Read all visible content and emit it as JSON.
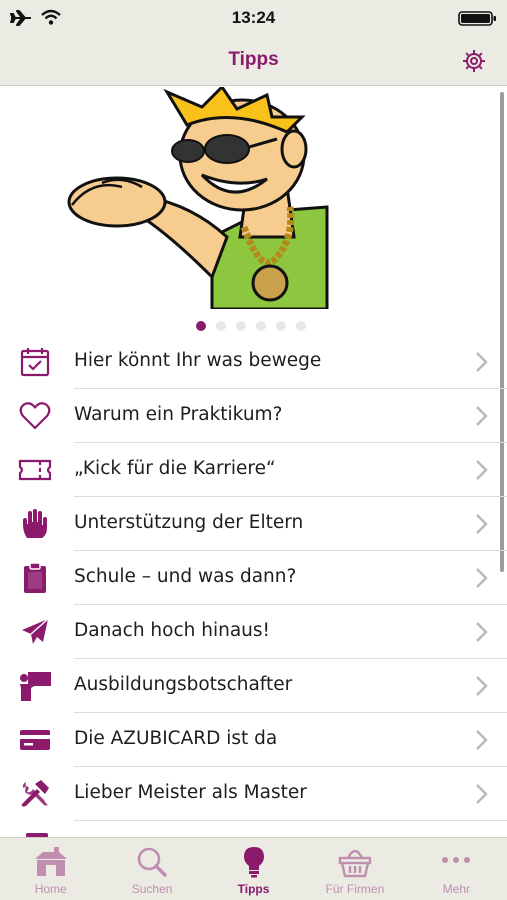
{
  "status_bar": {
    "time": "13:24"
  },
  "nav": {
    "title": "Tipps"
  },
  "carousel": {
    "page_count": 6,
    "active_index": 0
  },
  "list": {
    "items": [
      {
        "label": "Hier könnt Ihr was bewege",
        "icon": "calendar-check-icon"
      },
      {
        "label": "Warum ein Praktikum?",
        "icon": "heart-icon"
      },
      {
        "label": "„Kick für die Karriere“",
        "icon": "ticket-icon"
      },
      {
        "label": "Unterstützung der Eltern",
        "icon": "hand-icon"
      },
      {
        "label": "Schule – und was dann?",
        "icon": "clipboard-icon"
      },
      {
        "label": "Danach hoch hinaus!",
        "icon": "paper-plane-icon"
      },
      {
        "label": "Ausbildungsbotschafter",
        "icon": "presenter-icon"
      },
      {
        "label": "Die AZUBICARD ist da",
        "icon": "credit-card-icon"
      },
      {
        "label": "Lieber Meister als Master",
        "icon": "tools-icon"
      }
    ]
  },
  "tabs": [
    {
      "label": "Home",
      "icon": "house-icon",
      "active": false
    },
    {
      "label": "Suchen",
      "icon": "magnifier-icon",
      "active": false
    },
    {
      "label": "Tipps",
      "icon": "lightbulb-icon",
      "active": true
    },
    {
      "label": "Für Firmen",
      "icon": "basket-icon",
      "active": false
    },
    {
      "label": "Mehr",
      "icon": "more-dots-icon",
      "active": false
    }
  ],
  "colors": {
    "accent": "#8b1a6d",
    "tab_inactive": "#c08fb0",
    "bar_bg": "#ebebe3"
  }
}
